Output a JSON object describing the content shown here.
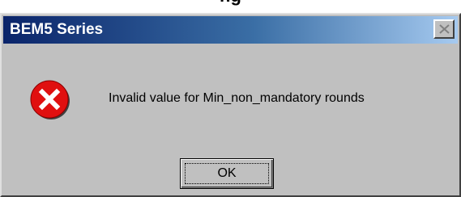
{
  "page": {
    "partial_heading_above": "ng"
  },
  "dialog": {
    "title": "BEM5 Series",
    "icon": "error-icon",
    "message": "Invalid value for Min_non_mandatory rounds",
    "ok_label": "OK"
  },
  "colors": {
    "title_gradient_start": "#0a246a",
    "title_gradient_end": "#a6caf0",
    "dialog_face": "#c0c0c0",
    "error_red": "#e01010"
  }
}
